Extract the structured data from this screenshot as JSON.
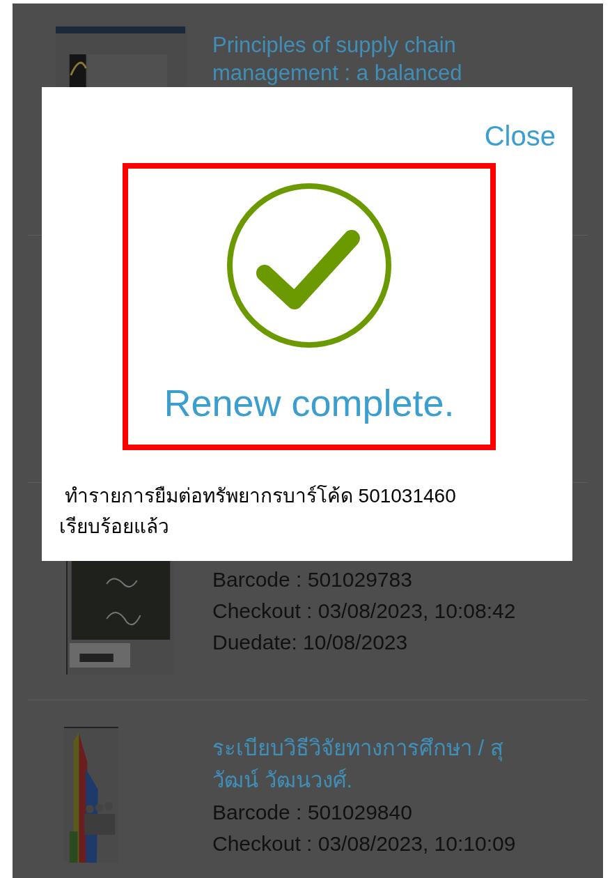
{
  "books": [
    {
      "title": "Principles of supply chain management : a balanced"
    },
    {
      "barcode": "Barcode : 501029783",
      "checkout": "Checkout : 03/08/2023, 10:08:42",
      "duedate": "Duedate: 10/08/2023"
    },
    {
      "title": "ระเบียบวิธีวิจัยทางการศึกษา / สุวัฒน์ วัฒนวงศ์.",
      "barcode": "Barcode : 501029840",
      "checkout": "Checkout : 03/08/2023, 10:10:09"
    }
  ],
  "dialog": {
    "close": "Close",
    "success": true,
    "heading": "Renew complete.",
    "message": " ทำรายการยืมต่อทรัพยากรบาร์โค้ด 501031460 เรียบร้อยแล้ว"
  }
}
